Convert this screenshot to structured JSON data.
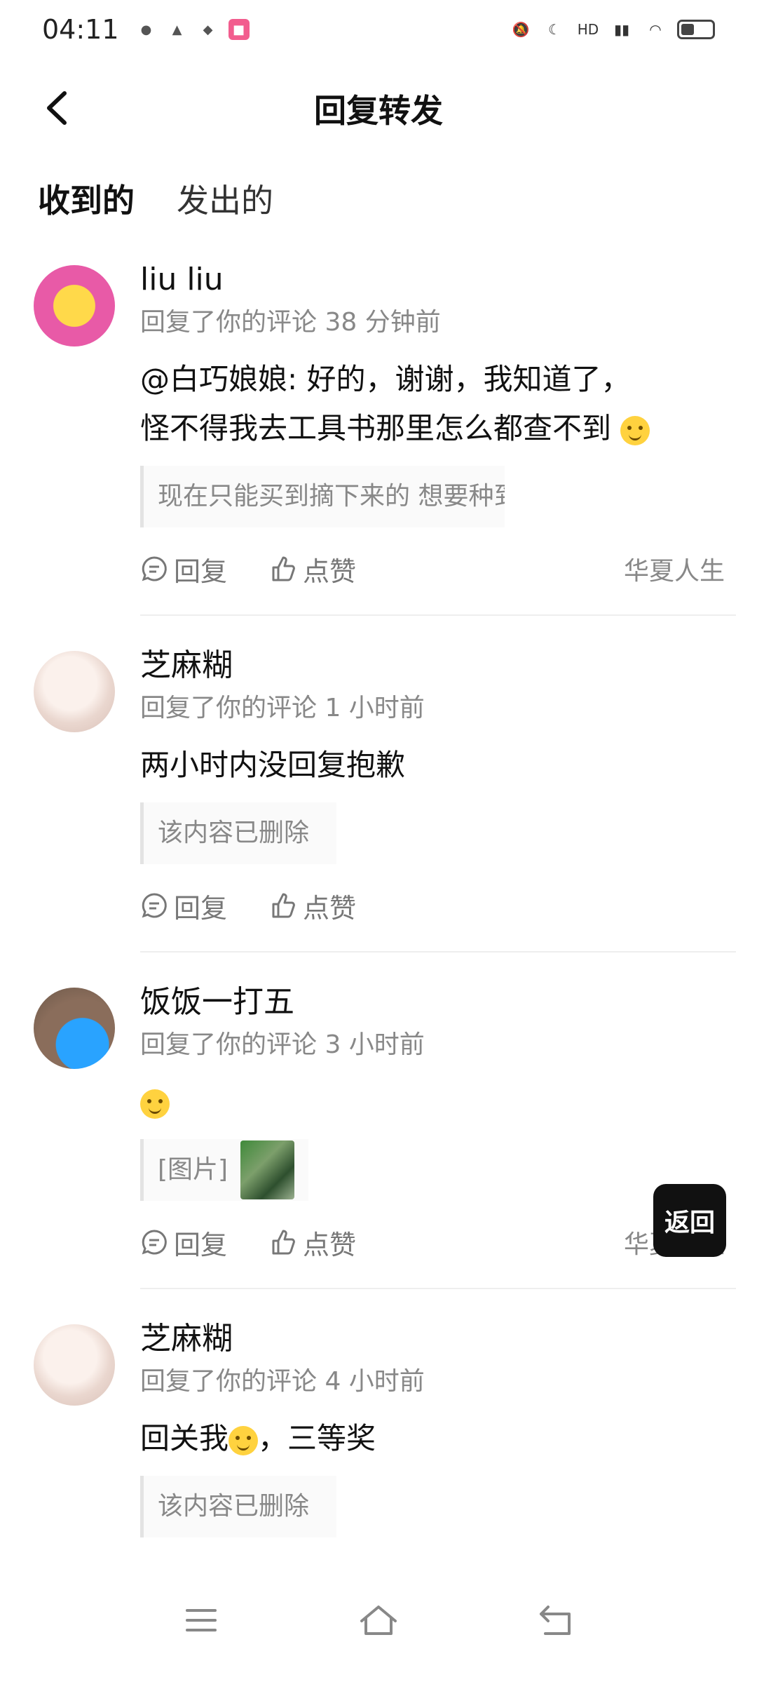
{
  "status": {
    "time": "04:11"
  },
  "header": {
    "title": "回复转发"
  },
  "tabs": [
    {
      "label": "收到的"
    },
    {
      "label": "发出的"
    }
  ],
  "items": [
    {
      "name": "liu liu",
      "meta": "回复了你的评论 38 分钟前",
      "content_line1": "@白巧娘娘: 好的，谢谢，我知道了，",
      "content_line2": "怪不得我去工具书那里怎么都查不到",
      "quote": "现在只能买到摘下来的 想要种到地上的...",
      "reply_label": "回复",
      "like_label": "点赞",
      "source": "华夏人生"
    },
    {
      "name": "芝麻糊",
      "meta": "回复了你的评论 1 小时前",
      "content": "两小时内没回复抱歉",
      "quote": "该内容已删除",
      "reply_label": "回复",
      "like_label": "点赞"
    },
    {
      "name": "饭饭一打五",
      "meta": "回复了你的评论 3 小时前",
      "quote": "[图片]",
      "reply_label": "回复",
      "like_label": "点赞",
      "source": "华夏人生"
    },
    {
      "name": "芝麻糊",
      "meta": "回复了你的评论 4 小时前",
      "content_before": "回关我",
      "content_after": "，三等奖",
      "quote": "该内容已删除"
    }
  ],
  "float_button": {
    "label": "返回"
  }
}
